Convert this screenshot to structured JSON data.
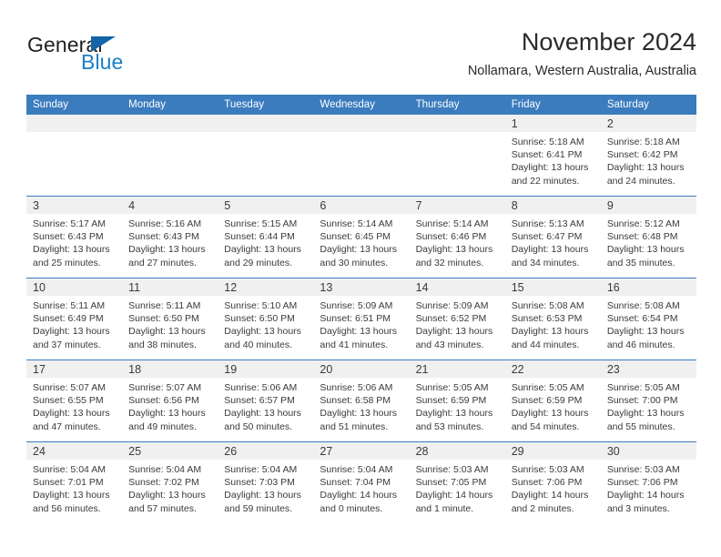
{
  "brand": {
    "name_part1": "General",
    "name_part2": "Blue",
    "flag_icon": "triangle-flag-icon",
    "accent_color": "#1364a8"
  },
  "header": {
    "title": "November 2024",
    "location": "Nollamara, Western Australia, Australia"
  },
  "theme": {
    "header_blue": "#3b7cbe",
    "daynum_strip": "#f0f0f0",
    "text": "#3a3a3a"
  },
  "weekday_headers": [
    "Sunday",
    "Monday",
    "Tuesday",
    "Wednesday",
    "Thursday",
    "Friday",
    "Saturday"
  ],
  "weeks": [
    [
      {
        "day": "",
        "empty": true,
        "sunrise": "",
        "sunset": "",
        "daylight_l1": "",
        "daylight_l2": ""
      },
      {
        "day": "",
        "empty": true,
        "sunrise": "",
        "sunset": "",
        "daylight_l1": "",
        "daylight_l2": ""
      },
      {
        "day": "",
        "empty": true,
        "sunrise": "",
        "sunset": "",
        "daylight_l1": "",
        "daylight_l2": ""
      },
      {
        "day": "",
        "empty": true,
        "sunrise": "",
        "sunset": "",
        "daylight_l1": "",
        "daylight_l2": ""
      },
      {
        "day": "",
        "empty": true,
        "sunrise": "",
        "sunset": "",
        "daylight_l1": "",
        "daylight_l2": ""
      },
      {
        "day": "1",
        "sunrise": "Sunrise: 5:18 AM",
        "sunset": "Sunset: 6:41 PM",
        "daylight_l1": "Daylight: 13 hours",
        "daylight_l2": "and 22 minutes."
      },
      {
        "day": "2",
        "sunrise": "Sunrise: 5:18 AM",
        "sunset": "Sunset: 6:42 PM",
        "daylight_l1": "Daylight: 13 hours",
        "daylight_l2": "and 24 minutes."
      }
    ],
    [
      {
        "day": "3",
        "sunrise": "Sunrise: 5:17 AM",
        "sunset": "Sunset: 6:43 PM",
        "daylight_l1": "Daylight: 13 hours",
        "daylight_l2": "and 25 minutes."
      },
      {
        "day": "4",
        "sunrise": "Sunrise: 5:16 AM",
        "sunset": "Sunset: 6:43 PM",
        "daylight_l1": "Daylight: 13 hours",
        "daylight_l2": "and 27 minutes."
      },
      {
        "day": "5",
        "sunrise": "Sunrise: 5:15 AM",
        "sunset": "Sunset: 6:44 PM",
        "daylight_l1": "Daylight: 13 hours",
        "daylight_l2": "and 29 minutes."
      },
      {
        "day": "6",
        "sunrise": "Sunrise: 5:14 AM",
        "sunset": "Sunset: 6:45 PM",
        "daylight_l1": "Daylight: 13 hours",
        "daylight_l2": "and 30 minutes."
      },
      {
        "day": "7",
        "sunrise": "Sunrise: 5:14 AM",
        "sunset": "Sunset: 6:46 PM",
        "daylight_l1": "Daylight: 13 hours",
        "daylight_l2": "and 32 minutes."
      },
      {
        "day": "8",
        "sunrise": "Sunrise: 5:13 AM",
        "sunset": "Sunset: 6:47 PM",
        "daylight_l1": "Daylight: 13 hours",
        "daylight_l2": "and 34 minutes."
      },
      {
        "day": "9",
        "sunrise": "Sunrise: 5:12 AM",
        "sunset": "Sunset: 6:48 PM",
        "daylight_l1": "Daylight: 13 hours",
        "daylight_l2": "and 35 minutes."
      }
    ],
    [
      {
        "day": "10",
        "sunrise": "Sunrise: 5:11 AM",
        "sunset": "Sunset: 6:49 PM",
        "daylight_l1": "Daylight: 13 hours",
        "daylight_l2": "and 37 minutes."
      },
      {
        "day": "11",
        "sunrise": "Sunrise: 5:11 AM",
        "sunset": "Sunset: 6:50 PM",
        "daylight_l1": "Daylight: 13 hours",
        "daylight_l2": "and 38 minutes."
      },
      {
        "day": "12",
        "sunrise": "Sunrise: 5:10 AM",
        "sunset": "Sunset: 6:50 PM",
        "daylight_l1": "Daylight: 13 hours",
        "daylight_l2": "and 40 minutes."
      },
      {
        "day": "13",
        "sunrise": "Sunrise: 5:09 AM",
        "sunset": "Sunset: 6:51 PM",
        "daylight_l1": "Daylight: 13 hours",
        "daylight_l2": "and 41 minutes."
      },
      {
        "day": "14",
        "sunrise": "Sunrise: 5:09 AM",
        "sunset": "Sunset: 6:52 PM",
        "daylight_l1": "Daylight: 13 hours",
        "daylight_l2": "and 43 minutes."
      },
      {
        "day": "15",
        "sunrise": "Sunrise: 5:08 AM",
        "sunset": "Sunset: 6:53 PM",
        "daylight_l1": "Daylight: 13 hours",
        "daylight_l2": "and 44 minutes."
      },
      {
        "day": "16",
        "sunrise": "Sunrise: 5:08 AM",
        "sunset": "Sunset: 6:54 PM",
        "daylight_l1": "Daylight: 13 hours",
        "daylight_l2": "and 46 minutes."
      }
    ],
    [
      {
        "day": "17",
        "sunrise": "Sunrise: 5:07 AM",
        "sunset": "Sunset: 6:55 PM",
        "daylight_l1": "Daylight: 13 hours",
        "daylight_l2": "and 47 minutes."
      },
      {
        "day": "18",
        "sunrise": "Sunrise: 5:07 AM",
        "sunset": "Sunset: 6:56 PM",
        "daylight_l1": "Daylight: 13 hours",
        "daylight_l2": "and 49 minutes."
      },
      {
        "day": "19",
        "sunrise": "Sunrise: 5:06 AM",
        "sunset": "Sunset: 6:57 PM",
        "daylight_l1": "Daylight: 13 hours",
        "daylight_l2": "and 50 minutes."
      },
      {
        "day": "20",
        "sunrise": "Sunrise: 5:06 AM",
        "sunset": "Sunset: 6:58 PM",
        "daylight_l1": "Daylight: 13 hours",
        "daylight_l2": "and 51 minutes."
      },
      {
        "day": "21",
        "sunrise": "Sunrise: 5:05 AM",
        "sunset": "Sunset: 6:59 PM",
        "daylight_l1": "Daylight: 13 hours",
        "daylight_l2": "and 53 minutes."
      },
      {
        "day": "22",
        "sunrise": "Sunrise: 5:05 AM",
        "sunset": "Sunset: 6:59 PM",
        "daylight_l1": "Daylight: 13 hours",
        "daylight_l2": "and 54 minutes."
      },
      {
        "day": "23",
        "sunrise": "Sunrise: 5:05 AM",
        "sunset": "Sunset: 7:00 PM",
        "daylight_l1": "Daylight: 13 hours",
        "daylight_l2": "and 55 minutes."
      }
    ],
    [
      {
        "day": "24",
        "sunrise": "Sunrise: 5:04 AM",
        "sunset": "Sunset: 7:01 PM",
        "daylight_l1": "Daylight: 13 hours",
        "daylight_l2": "and 56 minutes."
      },
      {
        "day": "25",
        "sunrise": "Sunrise: 5:04 AM",
        "sunset": "Sunset: 7:02 PM",
        "daylight_l1": "Daylight: 13 hours",
        "daylight_l2": "and 57 minutes."
      },
      {
        "day": "26",
        "sunrise": "Sunrise: 5:04 AM",
        "sunset": "Sunset: 7:03 PM",
        "daylight_l1": "Daylight: 13 hours",
        "daylight_l2": "and 59 minutes."
      },
      {
        "day": "27",
        "sunrise": "Sunrise: 5:04 AM",
        "sunset": "Sunset: 7:04 PM",
        "daylight_l1": "Daylight: 14 hours",
        "daylight_l2": "and 0 minutes."
      },
      {
        "day": "28",
        "sunrise": "Sunrise: 5:03 AM",
        "sunset": "Sunset: 7:05 PM",
        "daylight_l1": "Daylight: 14 hours",
        "daylight_l2": "and 1 minute."
      },
      {
        "day": "29",
        "sunrise": "Sunrise: 5:03 AM",
        "sunset": "Sunset: 7:06 PM",
        "daylight_l1": "Daylight: 14 hours",
        "daylight_l2": "and 2 minutes."
      },
      {
        "day": "30",
        "sunrise": "Sunrise: 5:03 AM",
        "sunset": "Sunset: 7:06 PM",
        "daylight_l1": "Daylight: 14 hours",
        "daylight_l2": "and 3 minutes."
      }
    ]
  ]
}
